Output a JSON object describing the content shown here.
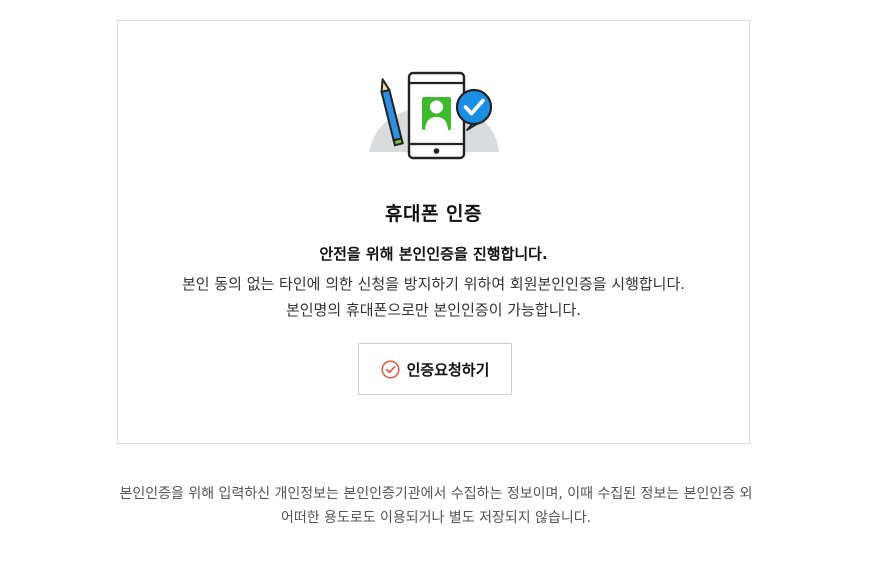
{
  "card": {
    "title": "휴대폰 인증",
    "subtitle": "안전을 위해 본인인증을 진행합니다.",
    "description_lines": [
      "본인 동의 없는 타인에 의한 신청을 방지하기 위하여 회원본인인증을 시행합니다.",
      "본인명의 휴대폰으로만 본인인증이 가능합니다."
    ],
    "button": {
      "label": "인증요청하기",
      "icon": "check-circle-icon"
    },
    "illustration": {
      "icons": [
        "pencil-icon",
        "phone-icon",
        "user-icon",
        "check-bubble-icon"
      ]
    }
  },
  "notice_lines": [
    "본인인증을 위해 입력하신 개인정보는 본인인증기관에서 수집하는 정보이며, 이때 수집된 정보는 본인인증 외",
    "어떠한 용도로도 이용되거나 별도 저장되지 않습니다."
  ],
  "colors": {
    "accent_green": "#3dbb2d",
    "accent_blue": "#1a8fe3",
    "button_icon": "#e2553b",
    "border": "#dcdcdc"
  }
}
